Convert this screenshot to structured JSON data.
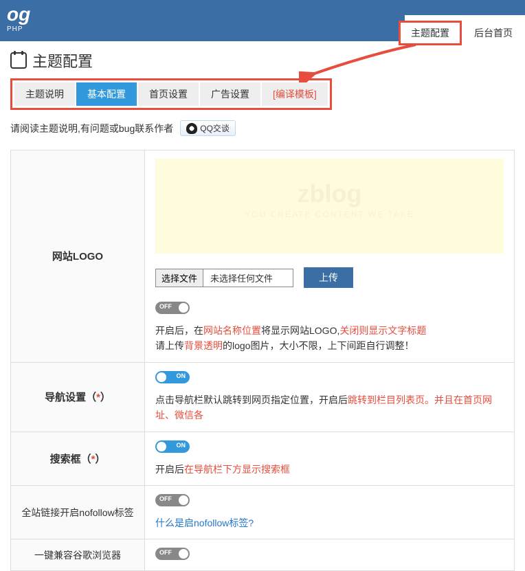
{
  "header": {
    "logo_text": "og",
    "logo_sub": "PHP",
    "nav": {
      "theme_config": "主题配置",
      "admin_home": "后台首页"
    }
  },
  "page": {
    "title": "主题配置",
    "tabs": {
      "desc": "主题说明",
      "basic": "基本配置",
      "home": "首页设置",
      "ads": "广告设置",
      "compile": "[编译模板]"
    },
    "note": "请阅读主题说明,有问题或bug联系作者",
    "qq_label": "QQ交谈"
  },
  "rows": {
    "logo": {
      "label": "网站LOGO",
      "preview_big": "zblog",
      "preview_small": "YOU CREATE CONTENT WE TAKE",
      "file_btn": "选择文件",
      "file_none": "未选择任何文件",
      "upload": "上传",
      "toggle_off": "OFF",
      "desc1_a": "开启后，在",
      "desc1_b": "网站名称位置",
      "desc1_c": "将显示网站LOGO,",
      "desc1_d": "关闭则显示文字标题",
      "desc2_a": "请上传",
      "desc2_b": "背景透明",
      "desc2_c": "的logo图片，大小不限，上下间距自行调整！"
    },
    "nav": {
      "label_a": "导航设置（",
      "label_b": "*",
      "label_c": "）",
      "toggle_on": "ON",
      "desc_a": "点击导航栏默认跳转到网页指定位置，开启后",
      "desc_b": "跳转到栏目列表页。并且在首页网址、微信各"
    },
    "search": {
      "label_a": "搜索框（",
      "label_b": "*",
      "label_c": "）",
      "toggle_on": "ON",
      "desc_a": "开启后",
      "desc_b": "在导航栏下方显示搜索框"
    },
    "nofollow": {
      "label": "全站链接开启nofollow标签",
      "toggle_off": "OFF",
      "desc": "什么是启nofollow标签?"
    },
    "chrome": {
      "label": "一键兼容谷歌浏览器",
      "toggle_off": "OFF"
    }
  }
}
